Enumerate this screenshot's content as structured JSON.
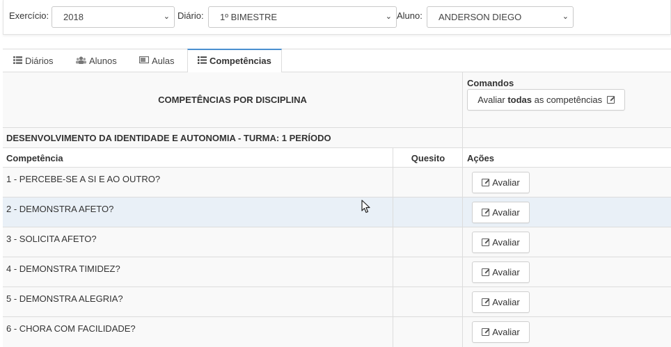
{
  "filters": {
    "exercicio": {
      "label": "Exercício:",
      "value": "2018"
    },
    "diario": {
      "label": "Diário:",
      "value": "1º BIMESTRE"
    },
    "aluno": {
      "label": "Aluno:",
      "value": "ANDERSON DIEGO"
    }
  },
  "tabs": [
    {
      "label": "Diários",
      "icon": "list-icon"
    },
    {
      "label": "Alunos",
      "icon": "users-icon"
    },
    {
      "label": "Aulas",
      "icon": "chalkboard-icon"
    },
    {
      "label": "Competências",
      "icon": "list-ul-icon",
      "active": true
    }
  ],
  "table": {
    "header_title": "COMPETÊNCIAS POR DISCIPLINA",
    "commands_label": "Comandos",
    "evaluate_all": {
      "prefix": "Avaliar ",
      "bold": "todas",
      "suffix": " as competências"
    },
    "group_title": "DESENVOLVIMENTO DA IDENTIDADE E AUTONOMIA - TURMA: 1 PERÍODO",
    "columns": {
      "competencia": "Competência",
      "quesito": "Quesito",
      "acoes": "Ações"
    },
    "rows": [
      {
        "competencia": "1 - PERCEBE-SE A SI E AO OUTRO?",
        "quesito": "",
        "action": "Avaliar"
      },
      {
        "competencia": "2 - DEMONSTRA AFETO?",
        "quesito": "",
        "action": "Avaliar"
      },
      {
        "competencia": "3 - SOLICITA AFETO?",
        "quesito": "",
        "action": "Avaliar"
      },
      {
        "competencia": "4 - DEMONSTRA TIMIDEZ?",
        "quesito": "",
        "action": "Avaliar"
      },
      {
        "competencia": "5 - DEMONSTRA ALEGRIA?",
        "quesito": "",
        "action": "Avaliar"
      },
      {
        "competencia": "6 - CHORA COM FACILIDADE?",
        "quesito": "",
        "action": "Avaliar"
      }
    ]
  },
  "colors": {
    "active_tab_border": "#4a8fd0",
    "hover_row": "#e9f0f7",
    "header_bg": "#f9f9f9"
  }
}
